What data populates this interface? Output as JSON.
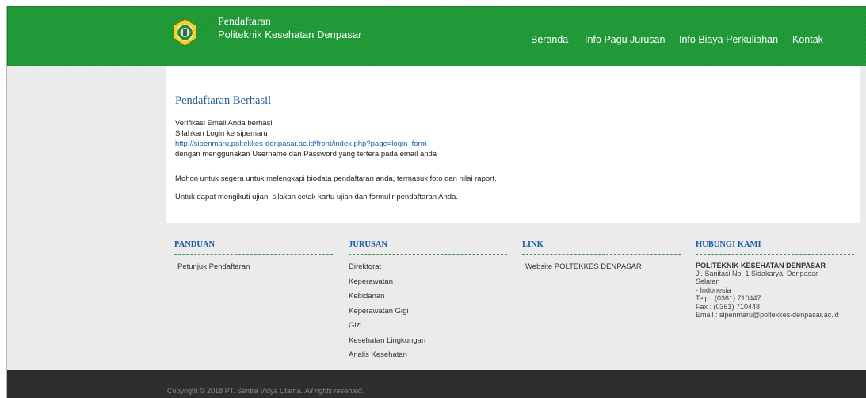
{
  "header": {
    "brand_line1": "Pendaftaran",
    "brand_line2": "Politeknik Kesehatan Denpasar",
    "nav": [
      "Beranda",
      "Info Pagu Jurusan",
      "Info Biaya Perkuliahan",
      "Kontak"
    ],
    "logo_icon": "poltekkes-emblem-icon",
    "bg_color": "#1e9735"
  },
  "content": {
    "title": "Pendaftaran Berhasil",
    "line1": "Verifikasi Email Anda berhasil",
    "line2": "Silahkan Login ke sipemaru",
    "login_link": "http://sipenmaru.poltekkes-denpasar.ac.id/front/index.php?page=login_form",
    "line3": "dengan menggunakan Username dan Password yang tertera pada email anda",
    "para1": "Mohon untuk segera untuk melengkapi biodata pendaftaran anda, termasuk foto dan nilai raport.",
    "para2": "Untuk dapat mengikuti ujian, silakan cetak kartu ujian dan formulir pendaftaran Anda."
  },
  "footer": {
    "panduan": {
      "title": "PANDUAN",
      "items": [
        "Petunjuk Pendaftaran"
      ]
    },
    "jurusan": {
      "title": "JURUSAN",
      "items": [
        "Direktorat",
        "Keperawatan",
        "Kebidanan",
        "Keperawatan Gigi",
        "Gizi",
        "Kesehatan Lingkungan",
        "Analis Kesehatan"
      ]
    },
    "link": {
      "title": "LINK",
      "items": [
        "Website POLTEKKES DENPASAR"
      ]
    },
    "kontak": {
      "title": "HUBUNGI KAMI",
      "name": "POLITEKNIK KESEHATAN DENPASAR",
      "lines": [
        "Jl. Sanitasi No. 1 Sidakarya, Denpasar",
        "Selatan",
        "- Indonesia",
        "Telp : (0361) 710447",
        "Fax : (0361) 710448",
        "Email : sipenmaru@poltekkes-denpasar.ac.id"
      ]
    }
  },
  "copyright": {
    "text": "Copyright © 2018 PT. Sentra Vidya Utama.",
    "rights": "All rights reserved."
  }
}
